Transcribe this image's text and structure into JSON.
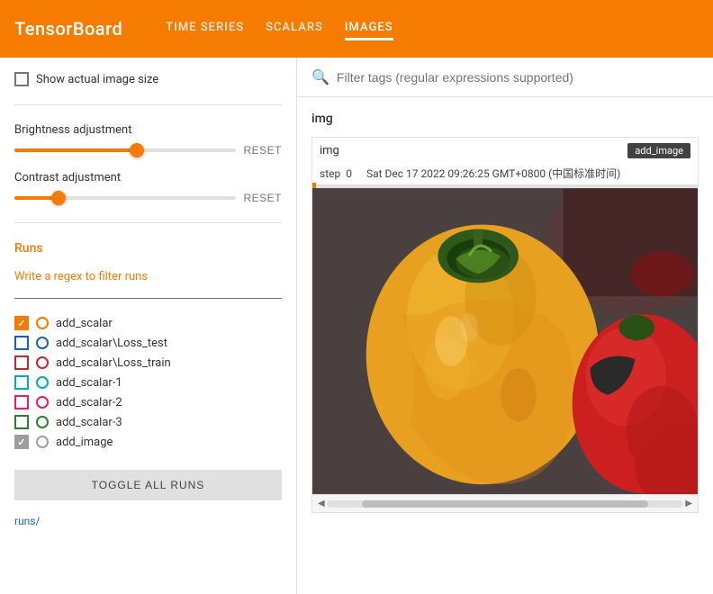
{
  "header": {
    "logo": "TensorBoard",
    "nav": [
      {
        "id": "time-series",
        "label": "TIME SERIES",
        "active": false
      },
      {
        "id": "scalars",
        "label": "SCALARS",
        "active": false
      },
      {
        "id": "images",
        "label": "IMAGES",
        "active": true
      }
    ]
  },
  "sidebar": {
    "show_actual_size_label": "Show actual image size",
    "brightness_label": "Brightness adjustment",
    "brightness_reset": "RESET",
    "brightness_value": 55,
    "contrast_label": "Contrast adjustment",
    "contrast_reset": "RESET",
    "contrast_value": 20,
    "runs_title": "Runs",
    "runs_regex_label": "Write a regex to filter runs",
    "runs": [
      {
        "name": "add_scalar",
        "checkbox_class": "checked-orange",
        "circle_color": "#f57c00",
        "checked": true
      },
      {
        "name": "add_scalar\\Loss_test",
        "checkbox_class": "unchecked-blue",
        "circle_color": "#1565c0",
        "checked": false
      },
      {
        "name": "add_scalar\\Loss_train",
        "checkbox_class": "unchecked-red",
        "circle_color": "#c62828",
        "checked": false
      },
      {
        "name": "add_scalar-1",
        "checkbox_class": "unchecked-cyan",
        "circle_color": "#00acc1",
        "checked": false
      },
      {
        "name": "add_scalar-2",
        "checkbox_class": "unchecked-pink",
        "circle_color": "#e91e63",
        "checked": false
      },
      {
        "name": "add_scalar-3",
        "checkbox_class": "unchecked-green",
        "circle_color": "#2e7d32",
        "checked": false
      },
      {
        "name": "add_image",
        "checkbox_class": "checked-gray",
        "circle_color": "#9e9e9e",
        "checked": true
      }
    ],
    "toggle_all_label": "TOGGLE ALL RUNS",
    "runs_link": "runs/"
  },
  "main": {
    "search_placeholder": "Filter tags (regular expressions supported)",
    "section_title": "img",
    "image_card": {
      "tag": "img",
      "badge": "add_image",
      "step_label": "step",
      "step_value": "0",
      "date": "Sat Dec 17 2022 09:26:25 GMT+0800 (中国标准时间)"
    }
  },
  "icons": {
    "search": "🔍",
    "left_arrow": "◀",
    "right_arrow": "▶"
  }
}
